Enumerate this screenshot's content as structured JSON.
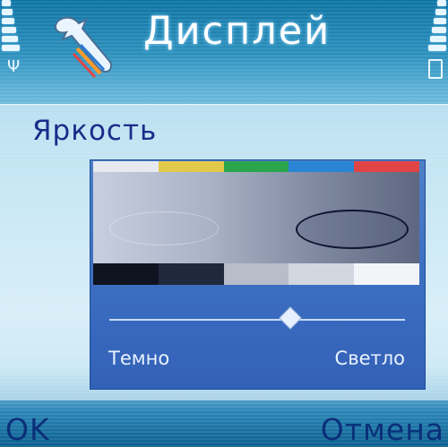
{
  "header": {
    "title": "Дисплей",
    "icon": "wrench-icon"
  },
  "setting": {
    "label": "Яркость",
    "color_strip": [
      "#e6eaf0",
      "#e3c94a",
      "#2aa54c",
      "#2a86d4",
      "#e04444"
    ],
    "gray_steps": [
      "#0f1420",
      "#20293b",
      "#b7bdc9",
      "#d3d7e0",
      "#f2f4f8"
    ],
    "min_label": "Темно",
    "max_label": "Светло",
    "level_fraction": 0.61
  },
  "softkeys": {
    "left": "OK",
    "right": "Отмена"
  },
  "accent_colors": {
    "title": "#ffffff",
    "label": "#1b2c8a",
    "softkey": "#0b2f7a"
  }
}
